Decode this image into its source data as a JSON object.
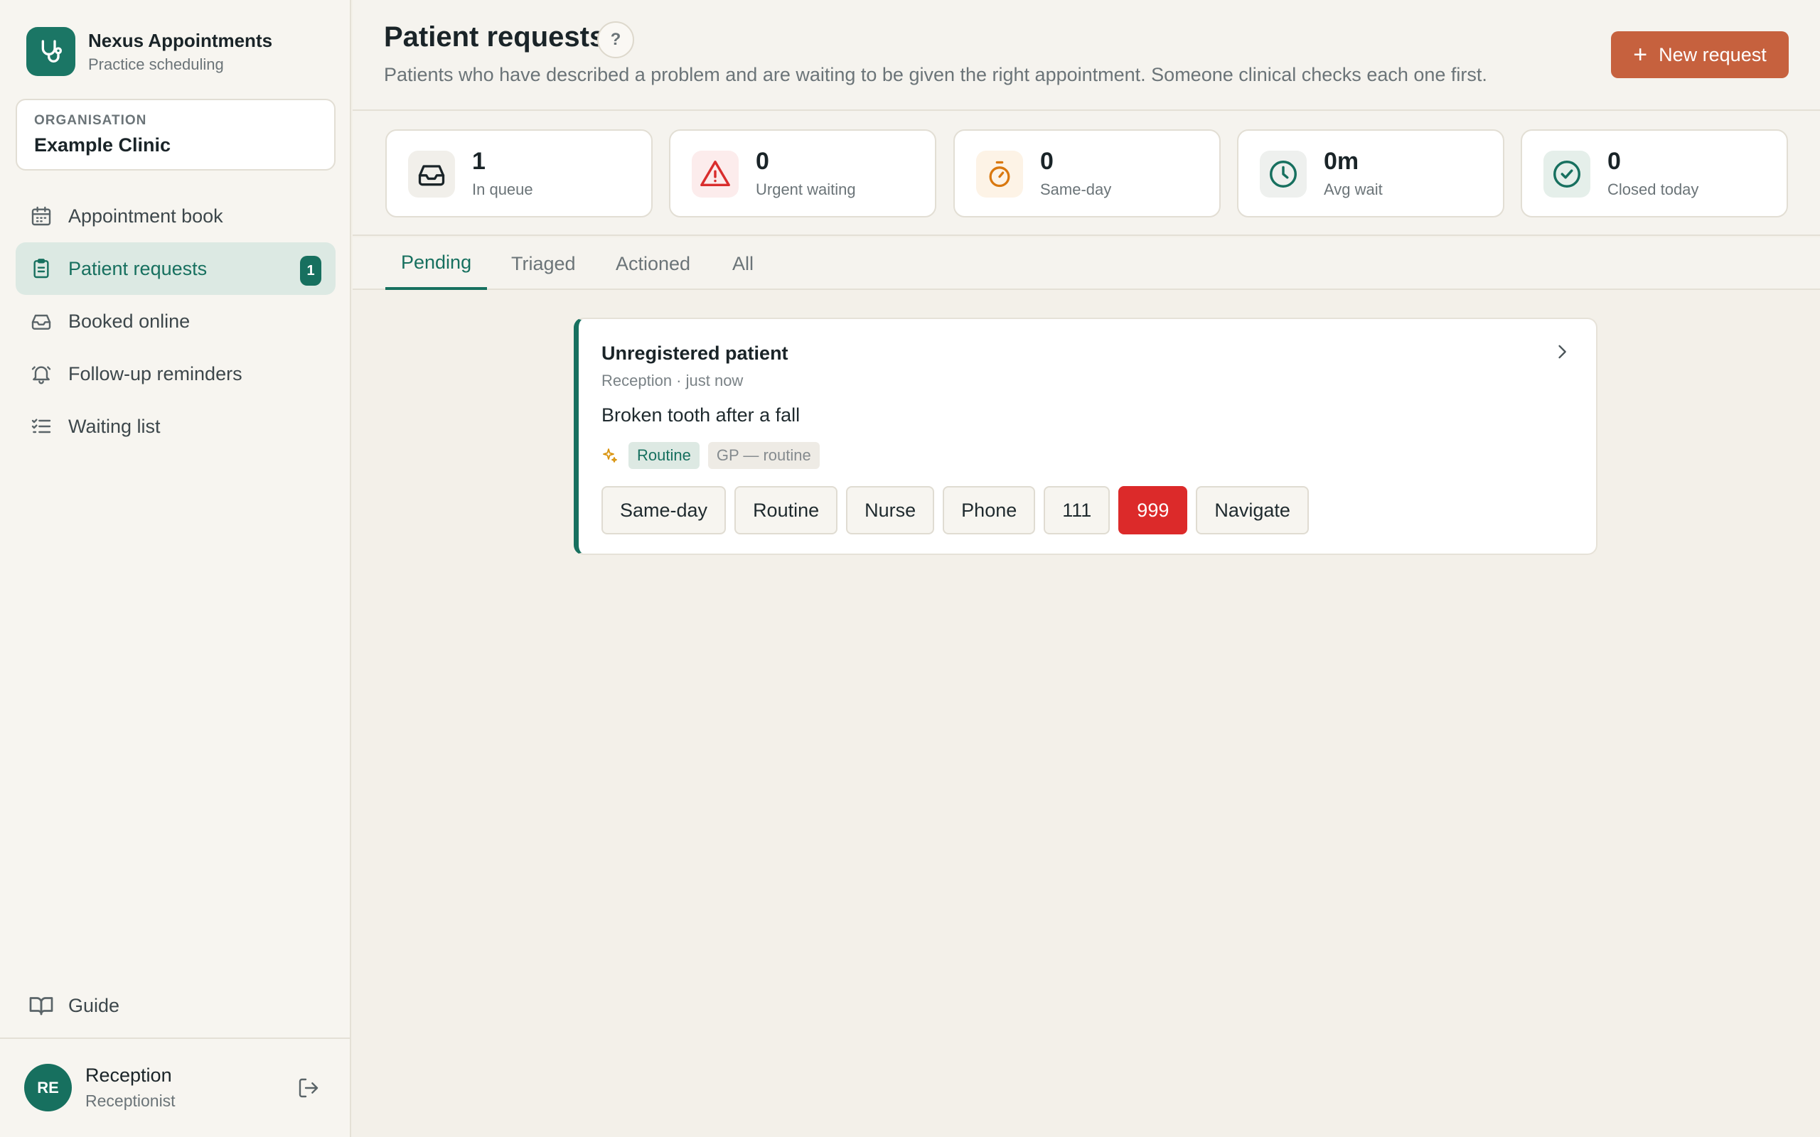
{
  "app": {
    "name": "Nexus Appointments",
    "subtitle": "Practice scheduling"
  },
  "organisation": {
    "label": "ORGANISATION",
    "name": "Example Clinic"
  },
  "sidebar": {
    "items": [
      {
        "label": "Appointment book",
        "icon": "calendar-icon"
      },
      {
        "label": "Patient requests",
        "icon": "clipboard-icon",
        "badge": "1",
        "active": true
      },
      {
        "label": "Booked online",
        "icon": "inbox-icon"
      },
      {
        "label": "Follow-up reminders",
        "icon": "bell-icon"
      },
      {
        "label": "Waiting list",
        "icon": "list-check-icon"
      }
    ],
    "guide_label": "Guide"
  },
  "user": {
    "initials": "RE",
    "name": "Reception",
    "role": "Receptionist"
  },
  "header": {
    "title": "Patient requests",
    "help": "?",
    "description": "Patients who have described a problem and are waiting to be given the right appointment. Someone clinical checks each one first.",
    "new_button": "New request",
    "new_button_icon": "+"
  },
  "stats": [
    {
      "value": "1",
      "label": "In queue",
      "icon": "inbox-icon",
      "color": "#1a2428",
      "bg": "#f1efea"
    },
    {
      "value": "0",
      "label": "Urgent waiting",
      "icon": "warning-icon",
      "color": "#d92d2d",
      "bg": "#fcecec"
    },
    {
      "value": "0",
      "label": "Same-day",
      "icon": "stopwatch-icon",
      "color": "#d9780f",
      "bg": "#fdf3e6"
    },
    {
      "value": "0m",
      "label": "Avg wait",
      "icon": "clock-icon",
      "color": "#17705f",
      "bg": "#eef0ee"
    },
    {
      "value": "0",
      "label": "Closed today",
      "icon": "check-circle-icon",
      "color": "#17705f",
      "bg": "#e5efea"
    }
  ],
  "tabs": [
    {
      "label": "Pending",
      "active": true
    },
    {
      "label": "Triaged"
    },
    {
      "label": "Actioned"
    },
    {
      "label": "All"
    }
  ],
  "requests": [
    {
      "patient": "Unregistered patient",
      "meta": "Reception · just now",
      "description": "Broken tooth after a fall",
      "tag_primary": "Routine",
      "tag_secondary": "GP — routine",
      "actions": [
        "Same-day",
        "Routine",
        "Nurse",
        "Phone",
        "111",
        "999",
        "Navigate"
      ]
    }
  ],
  "colors": {
    "accent": "#17705f",
    "brand_button": "#c6613e",
    "danger": "#dc2a2a"
  }
}
